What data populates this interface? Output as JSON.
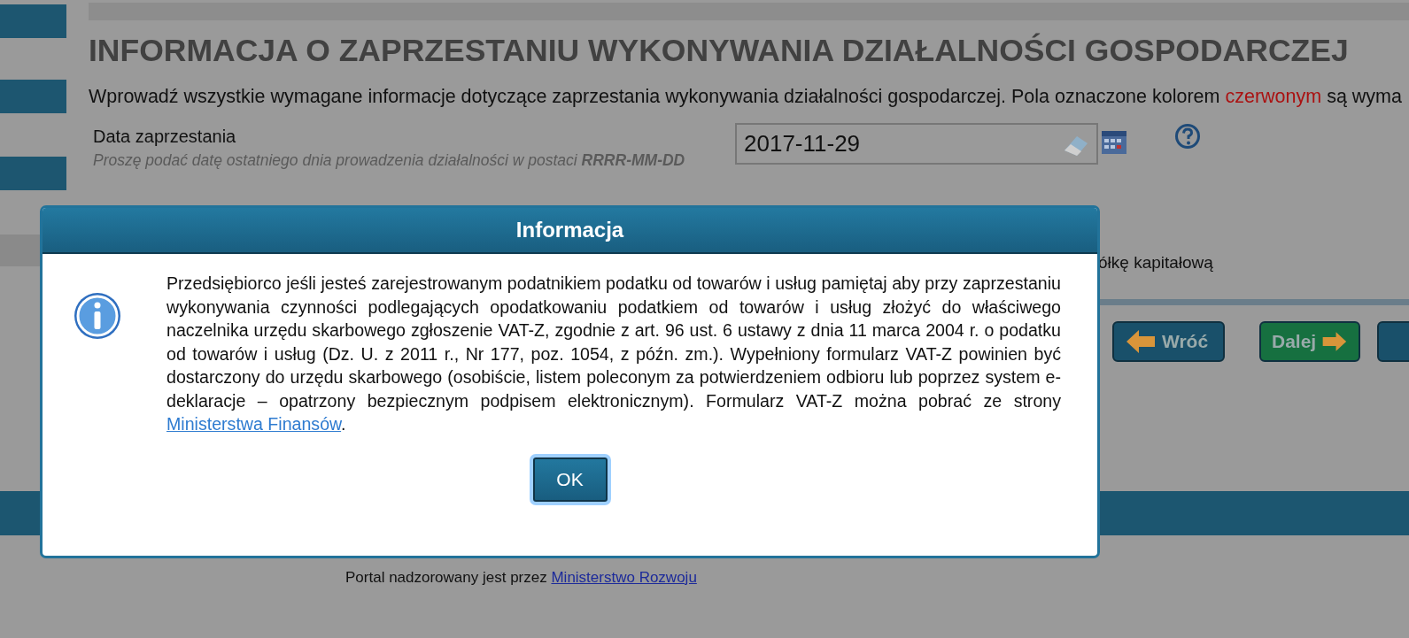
{
  "page": {
    "title": "INFORMACJA O ZAPRZESTANIU WYKONYWANIA DZIAŁALNOŚCI GOSPODARCZEJ",
    "intro": {
      "before": "Wprowadź wszystkie wymagane informacje dotyczące zaprzestania wykonywania działalności gospodarczej. Pola oznaczone kolorem ",
      "highlight": "czerwonym",
      "after": " są wyma"
    },
    "date_field": {
      "label": "Data zaprzestania",
      "hint": "Proszę podać datę ostatniego dnia prowadzenia działalności w postaci **RRRR-MM-DD**",
      "value": "2017-11-29"
    },
    "option_text": "ółkę kapitałową",
    "buttons": [
      {
        "label": "Wróć",
        "kind": "back"
      },
      {
        "label": "Dalej",
        "kind": "next"
      },
      {
        "kind": "more"
      }
    ],
    "footer": {
      "text": "Portal nadzorowany jest przez ",
      "link": "Ministerstwo Rozwoju"
    }
  },
  "dialog": {
    "title": "Informacja",
    "message": {
      "text": "Przedsiębiorco jeśli jesteś zarejestrowanym podatnikiem podatku od towarów i usług pamiętaj aby przy zaprzestaniu wykonywania czynności podlegających opodatkowaniu podatkiem od towarów i usług złożyć do właściwego naczelnika urzędu skarbowego zgłoszenie VAT-Z, zgodnie z art. 96 ust. 6 ustawy z dnia 11 marca 2004 r. o podatku od towarów i usług (Dz. U. z 2011 r., Nr 177, poz. 1054, z późn. zm.). Wypełniony formularz VAT-Z powinien być dostarczony do urzędu skarbowego (osobiście, listem poleconym za potwierdzeniem odbioru lub poprzez system e-deklaracje – opatrzony bezpiecznym podpisem elektronicznym). Formularz VAT-Z można pobrać ze strony ",
      "link": "Ministerstwa Finansów",
      "end": "."
    },
    "ok": "OK"
  }
}
